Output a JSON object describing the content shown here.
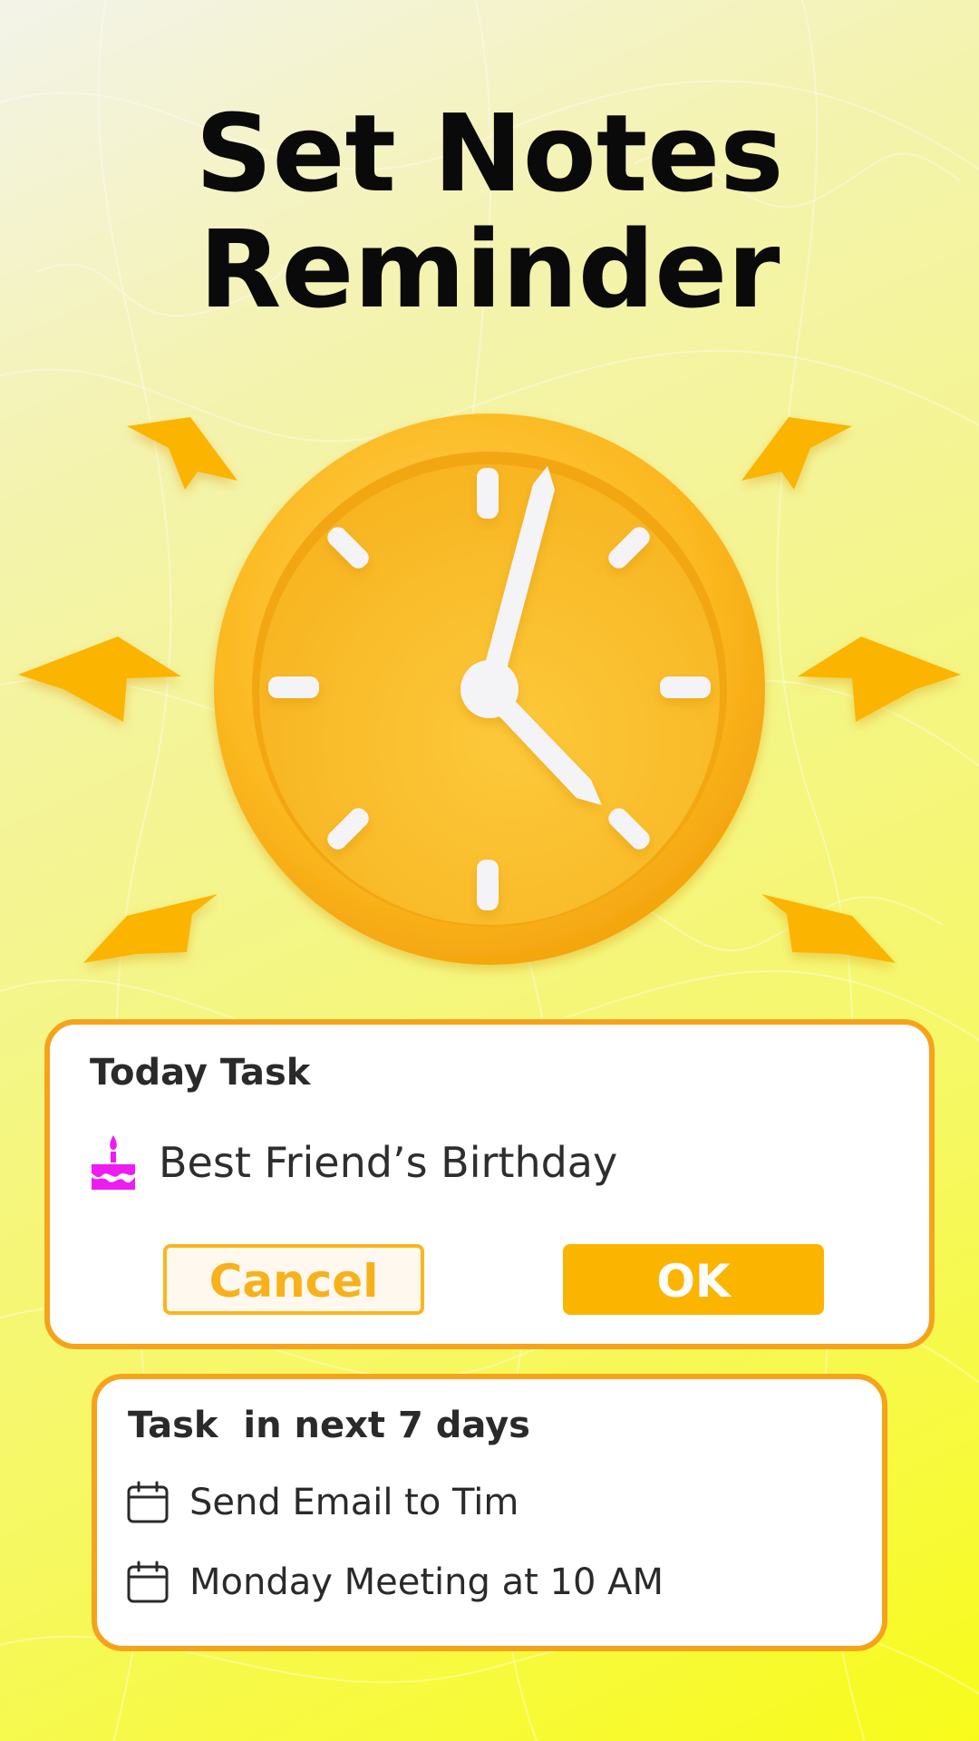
{
  "header": {
    "title_line1": "Set Notes",
    "title_line2": "Reminder"
  },
  "illustration": {
    "icon": "alarm-clock-icon",
    "accent_color": "#fbb400"
  },
  "today_card": {
    "title": "Today Task",
    "task": {
      "icon": "birthday-cake-icon",
      "label": "Best Friend’s Birthday"
    },
    "cancel_label": "Cancel",
    "ok_label": "OK"
  },
  "week_card": {
    "title": "Task  in next 7 days",
    "items": [
      {
        "icon": "calendar-icon",
        "label": "Send Email to Tim"
      },
      {
        "icon": "calendar-icon",
        "label": "Monday Meeting at 10 AM"
      }
    ]
  },
  "colors": {
    "card_border": "#f7a21b",
    "button_primary": "#fbb400",
    "cake": "#ee1cf2"
  }
}
